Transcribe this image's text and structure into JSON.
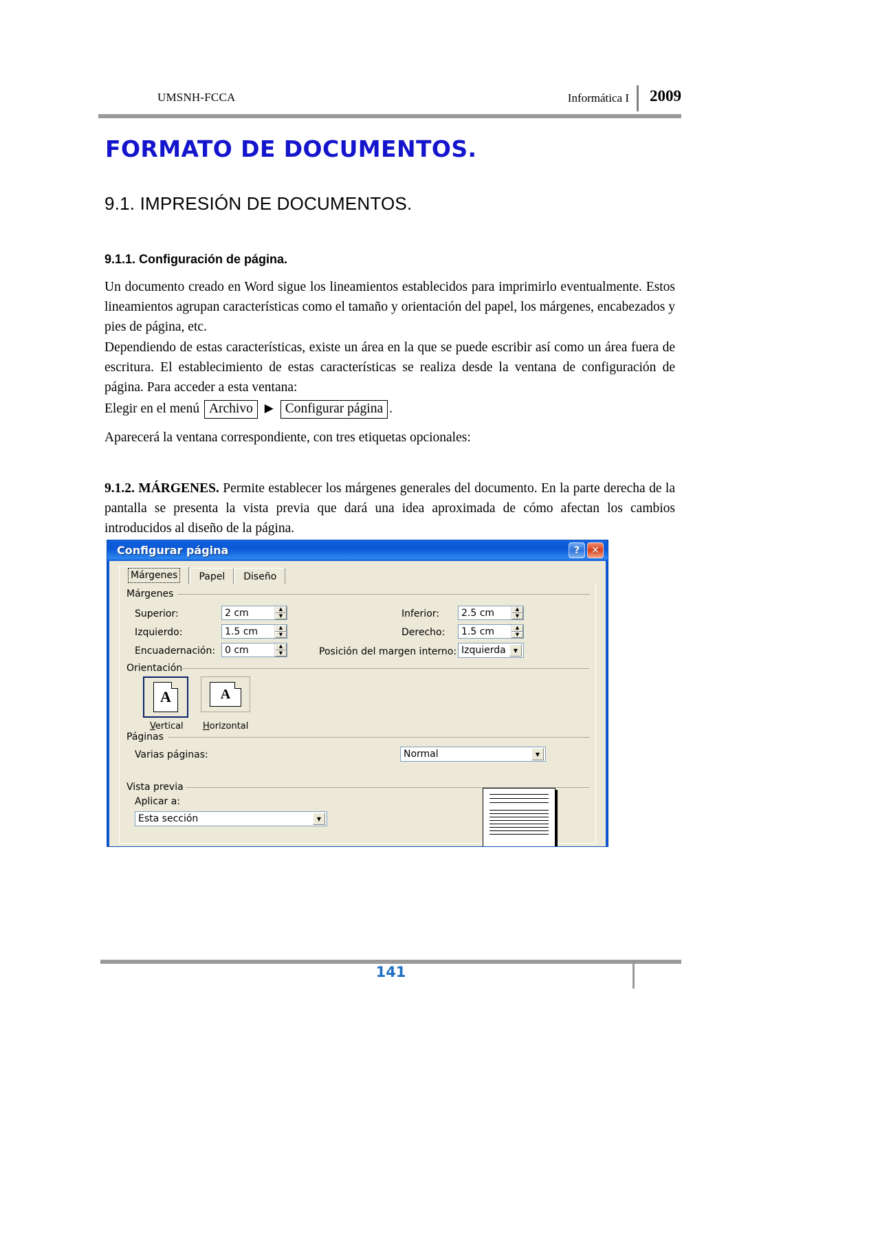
{
  "header": {
    "left": "UMSNH-FCCA",
    "course": "Informática I",
    "year": "2009"
  },
  "title": "FORMATO DE DOCUMENTOS.",
  "headings": {
    "h2": "9.1. IMPRESIÓN DE DOCUMENTOS.",
    "h3": "9.1.1. Configuración de página."
  },
  "paragraphs": {
    "p1": "Un documento creado en Word sigue los lineamientos establecidos para imprimirlo eventualmente. Estos lineamientos agrupan características como el tamaño y orientación del papel, los márgenes, encabezados y pies de página, etc.",
    "p2": "Dependiendo de estas características, existe un área en la que se puede escribir así como un área fuera de escritura. El establecimiento de estas características se realiza desde la ventana de configuración de página. Para acceder a esta ventana:",
    "menu_lead": "Elegir en el menú",
    "menu_item_1": "Archivo",
    "menu_arrow": "▶",
    "menu_item_2": "Configurar página",
    "menu_end": ".",
    "p3": "Aparecerá la ventana correspondiente, con tres etiquetas opcionales:",
    "p4_bold": "9.1.2. MÁRGENES.",
    "p4_rest": " Permite establecer los márgenes generales del documento. En la parte derecha de la pantalla se presenta la vista previa que dará una idea aproximada de cómo afectan los cambios introducidos al diseño de la página."
  },
  "dialog": {
    "title": "Configurar página",
    "help_button": "?",
    "close_button": "✕",
    "tabs": [
      {
        "label": "Márgenes",
        "active": true
      },
      {
        "label": "Papel",
        "active": false
      },
      {
        "label": "Diseño",
        "active": false
      }
    ],
    "groups": {
      "margins": "Márgenes",
      "orientation": "Orientación",
      "pages": "Páginas",
      "preview": "Vista previa"
    },
    "fields": {
      "superior_label": "Superior:",
      "superior_value": "2 cm",
      "inferior_label": "Inferior:",
      "inferior_value": "2.5 cm",
      "izquierdo_label": "Izquierdo:",
      "izquierdo_value": "1.5 cm",
      "derecho_label": "Derecho:",
      "derecho_value": "1.5 cm",
      "encuadernacion_label": "Encuadernación:",
      "encuadernacion_value": "0 cm",
      "posicion_label": "Posición del margen interno:",
      "posicion_value": "Izquierda",
      "varias_paginas_label": "Varias páginas:",
      "varias_paginas_value": "Normal",
      "aplicar_a_label": "Aplicar a:",
      "aplicar_a_value": "Esta sección"
    },
    "orientation": {
      "vertical_label": "Vertical",
      "horizontal_label": "Horizontal",
      "page_glyph": "A",
      "selected": "Vertical"
    },
    "spinner_up": "▲",
    "spinner_down": "▼",
    "combo_arrow": "▼"
  },
  "footer": {
    "page_number": "141"
  },
  "colors": {
    "title_blue": "#1414CD",
    "titlebar_blue": "#0A58D6",
    "dialog_face": "#ECE9D8",
    "rule_gray": "#9A9A9A",
    "footer_blue": "#1F6FC4"
  }
}
